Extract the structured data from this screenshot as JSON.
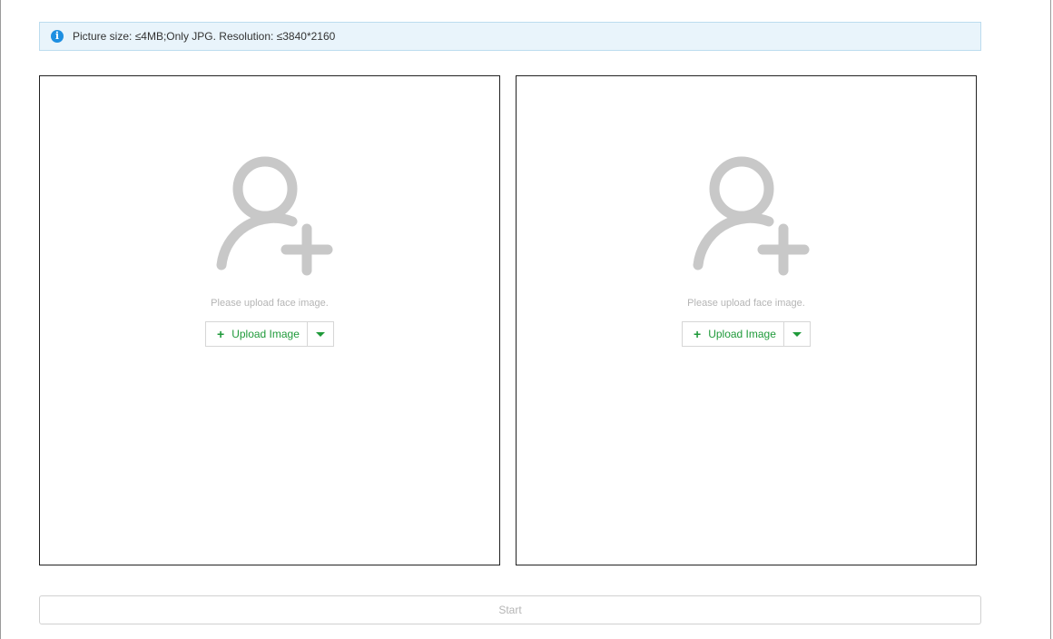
{
  "info": {
    "icon": "info-icon",
    "icon_glyph": "i",
    "text": "Picture size: ≤4MB;Only JPG. Resolution: ≤3840*2160"
  },
  "panels": [
    {
      "icon": "add-person-icon",
      "hint": "Please upload face image.",
      "upload_plus": "+",
      "upload_label": "Upload Image",
      "dropdown_icon": "caret-down-icon"
    },
    {
      "icon": "add-person-icon",
      "hint": "Please upload face image.",
      "upload_plus": "+",
      "upload_label": "Upload Image",
      "dropdown_icon": "caret-down-icon"
    }
  ],
  "start_label": "Start",
  "colors": {
    "accent_green": "#1f9a3a",
    "info_blue": "#1e8fe1",
    "info_bg": "#e9f4fb",
    "placeholder_gray": "#c8c8c8"
  }
}
